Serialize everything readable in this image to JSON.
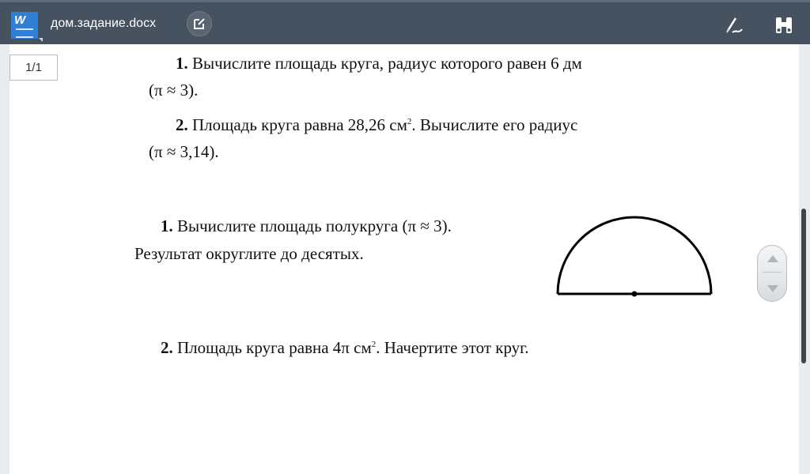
{
  "titlebar": {
    "filename": "дом.задание.docx",
    "app_icon_letter": "W",
    "icons": [
      "word-doc-icon",
      "edit-icon",
      "pen-icon",
      "binoculars-icon"
    ]
  },
  "page_indicator": "1/1",
  "problems": {
    "p1_num": "1.",
    "p1_line1": "Вычислите площадь круга, радиус которого равен 6 дм",
    "p1_line2": "(π ≈ 3).",
    "p2_num": "2.",
    "p2_line1a": "Площадь круга равна 28,26 см",
    "p2_sup": "2",
    "p2_line1b": ". Вычислите его радиус",
    "p2_line2": "(π ≈ 3,14).",
    "p3_num": "1.",
    "p3_line1": "Вычислите площадь полукруга (π ≈ 3).",
    "p3_line2": "Результат округлите до десятых.",
    "p4_num": "2.",
    "p4_line_a": "Площадь круга равна 4π см",
    "p4_sup": "2",
    "p4_line_b": ". Начертите этот круг."
  },
  "colors": {
    "titlebar": "#475260",
    "word_icon": "#2f7fd4"
  }
}
